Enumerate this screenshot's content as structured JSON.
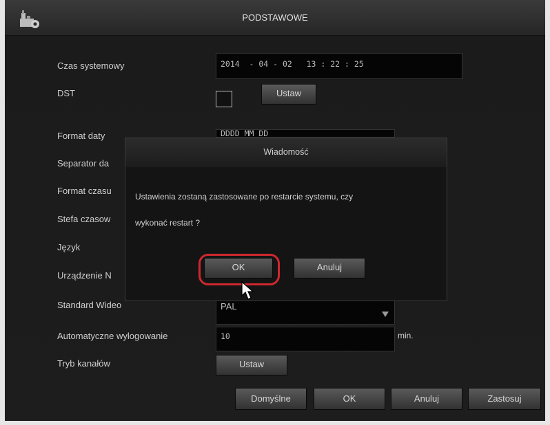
{
  "window": {
    "title": "PODSTAWOWE",
    "icon": "settings-icon"
  },
  "form": {
    "system_time": {
      "label": "Czas systemowy",
      "value": "2014  - 04 - 02   13 : 22 : 25"
    },
    "dst": {
      "label": "DST",
      "checked": false,
      "button": "Ustaw"
    },
    "date_format": {
      "label": "Format daty",
      "value": "DDDD MM DD"
    },
    "date_separator": {
      "label": "Separator da"
    },
    "time_format": {
      "label": "Format czasu"
    },
    "timezone": {
      "label": "Stefa czasow"
    },
    "language": {
      "label": "Język"
    },
    "device": {
      "label": "Urządzenie N"
    },
    "video_standard": {
      "label": "Standard Wideo",
      "value": "PAL"
    },
    "auto_logout": {
      "label": "Automatyczne wylogowanie",
      "value": "10",
      "unit": "min."
    },
    "channel_mode": {
      "label": "Tryb kanałów",
      "button": "Ustaw"
    }
  },
  "footer": {
    "defaults": "Domyślne",
    "ok": "OK",
    "cancel": "Anuluj",
    "apply": "Zastosuj"
  },
  "dialog": {
    "title": "Wiadomość",
    "line1": "Ustawienia zostaną zastosowane po restarcie systemu, czy",
    "line2": "wykonać restart ?",
    "ok": "OK",
    "cancel": "Anuluj"
  },
  "colors": {
    "highlight": "#d0282e",
    "background": "#1d1d1d"
  }
}
